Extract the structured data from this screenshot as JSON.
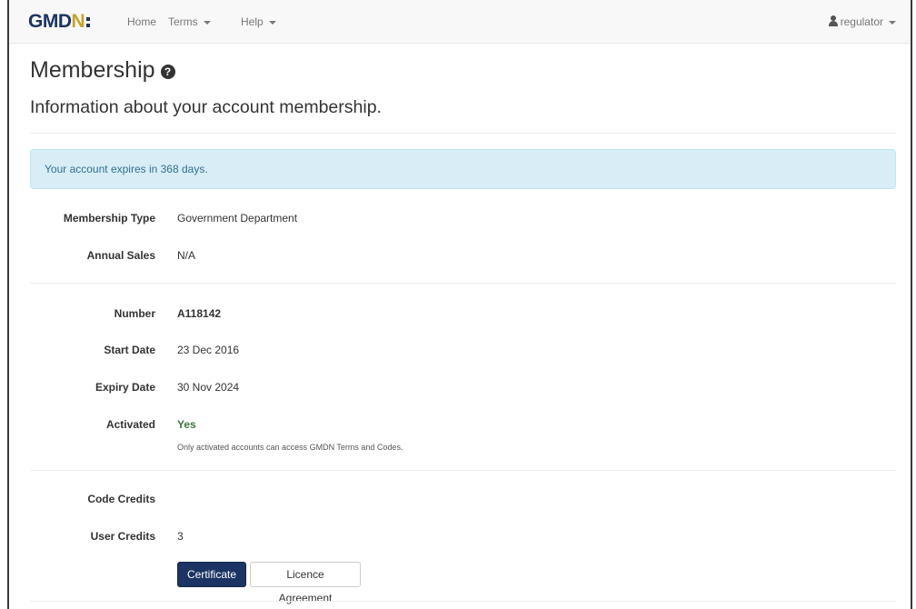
{
  "navbar": {
    "brand_main": "GMD",
    "brand_accent": "N",
    "home": "Home",
    "terms": "Terms",
    "help": "Help",
    "user": "regulator"
  },
  "page": {
    "title": "Membership",
    "subtitle": "Information about your account membership."
  },
  "alert": {
    "text": "Your account expires in 368 days."
  },
  "membership": {
    "type_label": "Membership Type",
    "type_value": "Government Department",
    "sales_label": "Annual Sales",
    "sales_value": "N/A",
    "number_label": "Number",
    "number_value": "A118142",
    "start_label": "Start Date",
    "start_value": "23 Dec 2016",
    "expiry_label": "Expiry Date",
    "expiry_value": "30 Nov 2024",
    "activated_label": "Activated",
    "activated_value": "Yes",
    "activated_help": "Only activated accounts can access GMDN Terms and Codes.",
    "code_credits_label": "Code Credits",
    "code_credits_value": "",
    "user_credits_label": "User Credits",
    "user_credits_value": "3"
  },
  "buttons": {
    "certificate": "Certificate",
    "licence": "Licence Agreement"
  },
  "colors": {
    "brand_navy": "#1b3464",
    "brand_gold": "#c9a227",
    "alert_bg": "#d9edf7",
    "alert_text": "#31708f",
    "success_green": "#3c763d"
  },
  "icons": {
    "help": "question-circle-icon",
    "user": "user-icon",
    "caret": "caret-down-icon"
  }
}
